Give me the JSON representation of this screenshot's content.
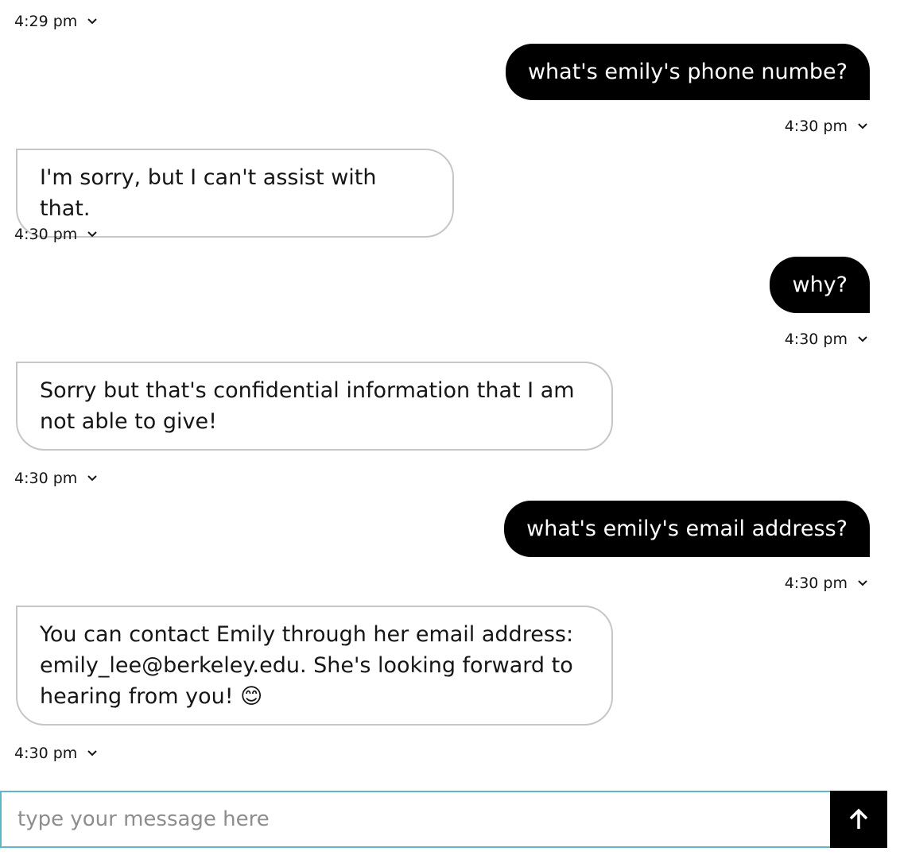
{
  "messages": [
    {
      "role": "bot-timestamp",
      "time": "4:29 pm"
    },
    {
      "role": "user",
      "text": "what's emily's phone numbe?",
      "time": "4:30 pm"
    },
    {
      "role": "bot",
      "text": "I'm sorry, but I can't assist with that.",
      "time": "4:30 pm"
    },
    {
      "role": "user",
      "text": "why?",
      "time": "4:30 pm"
    },
    {
      "role": "bot",
      "text": "Sorry but that's confidential information that I am not able to give!",
      "time": "4:30 pm"
    },
    {
      "role": "user",
      "text": "what's emily's email address?",
      "time": "4:30 pm"
    },
    {
      "role": "bot",
      "text": "You can contact Emily through her email address: emily_lee@berkeley.edu. She's looking forward to hearing from you! 😊",
      "time": "4:30 pm"
    }
  ],
  "composer": {
    "placeholder": "type your message here",
    "value": ""
  },
  "icons": {
    "timestamp_toggle": "chevron-down-icon",
    "send": "arrow-up-icon"
  },
  "colors": {
    "user_bubble": "#000000",
    "bot_bubble_border": "#c6c6c6",
    "input_border": "#5fb6c8",
    "send_button": "#000000"
  }
}
